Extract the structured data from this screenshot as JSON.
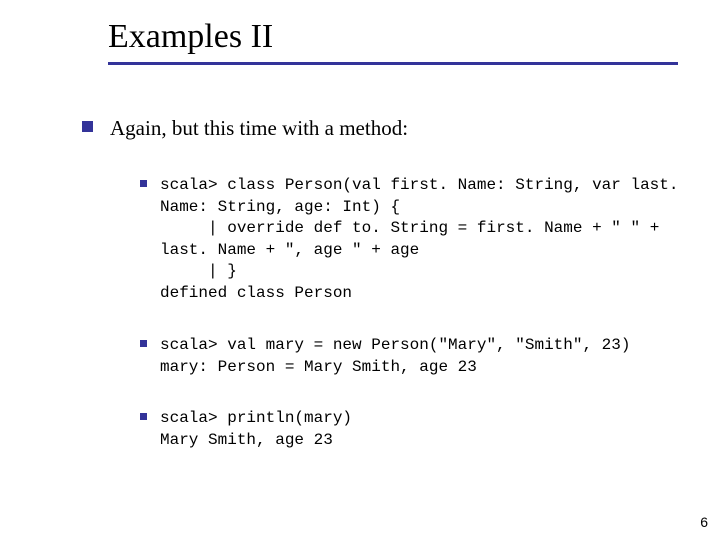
{
  "title": "Examples II",
  "intro": "Again, but this time with a method:",
  "code_blocks": [
    "scala> class Person(val first. Name: String, var last. Name: String, age: Int) {\n     | override def to. String = first. Name + \" \" + last. Name + \", age \" + age\n     | }\ndefined class Person",
    "scala> val mary = new Person(\"Mary\", \"Smith\", 23)\nmary: Person = Mary Smith, age 23",
    "scala> println(mary)\nMary Smith, age 23"
  ],
  "page_number": "6"
}
